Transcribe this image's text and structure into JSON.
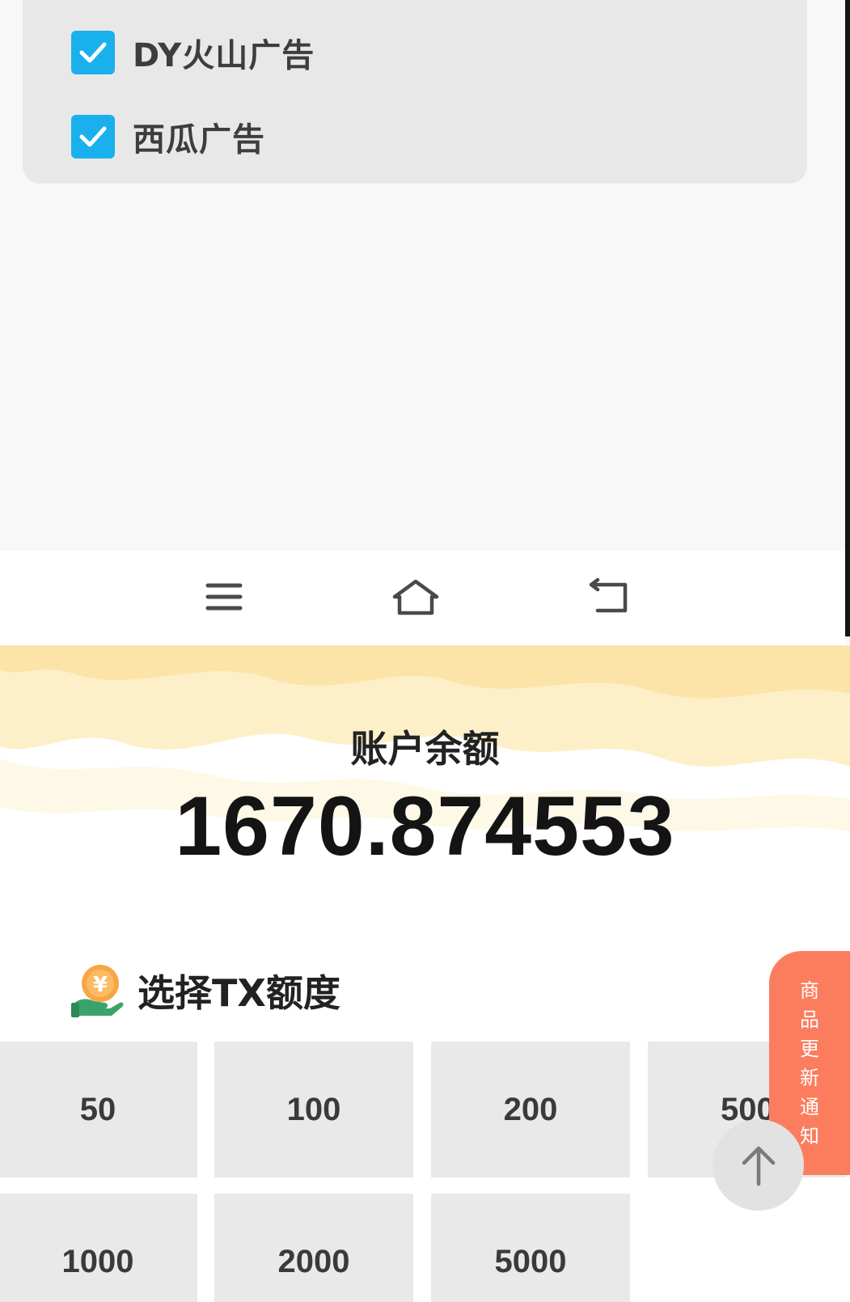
{
  "ad_settings": {
    "options": [
      {
        "label": "DY火山广告",
        "checked": true
      },
      {
        "label": "西瓜广告",
        "checked": true
      }
    ]
  },
  "system_nav": {
    "icons": [
      "menu-icon",
      "home-icon",
      "back-icon"
    ]
  },
  "wallet": {
    "balance_label": "账户余额",
    "balance_value": "1670.874553",
    "section_title": "选择TX额度",
    "section_icon": "coin-hand-icon",
    "amounts": [
      "50",
      "100",
      "200",
      "500",
      "1000",
      "2000",
      "5000"
    ]
  },
  "notice_tab": {
    "chars": [
      "商",
      "品",
      "更",
      "新",
      "通",
      "知"
    ]
  },
  "colors": {
    "checkbox": "#1ab0ee",
    "notice_tab": "#fb7d5d",
    "amount_tile": "#e9e9e9",
    "wave_yellow": "#fde9b3"
  }
}
